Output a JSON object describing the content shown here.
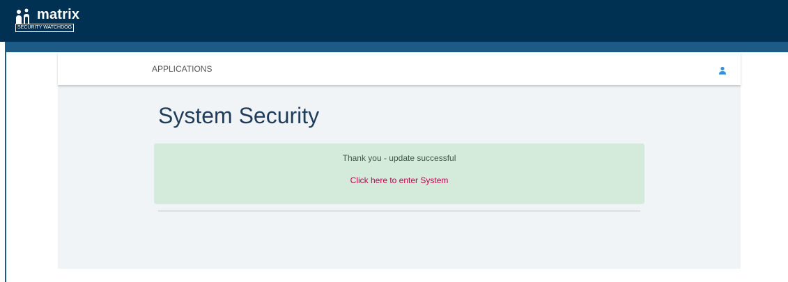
{
  "header": {
    "logo_text": "matrix",
    "logo_subtext": "SECURITY WATCHDOG"
  },
  "nav": {
    "applications_label": "APPLICATIONS",
    "user_icon": "user-icon"
  },
  "main": {
    "title": "System Security",
    "alert": {
      "message": "Thank you - update successful",
      "link_text": "Click here to enter System"
    }
  },
  "colors": {
    "header_bg": "#003153",
    "accent": "#1e5a86",
    "alert_bg": "#d4eadb",
    "link": "#c4004f",
    "title": "#1f3d5a"
  }
}
